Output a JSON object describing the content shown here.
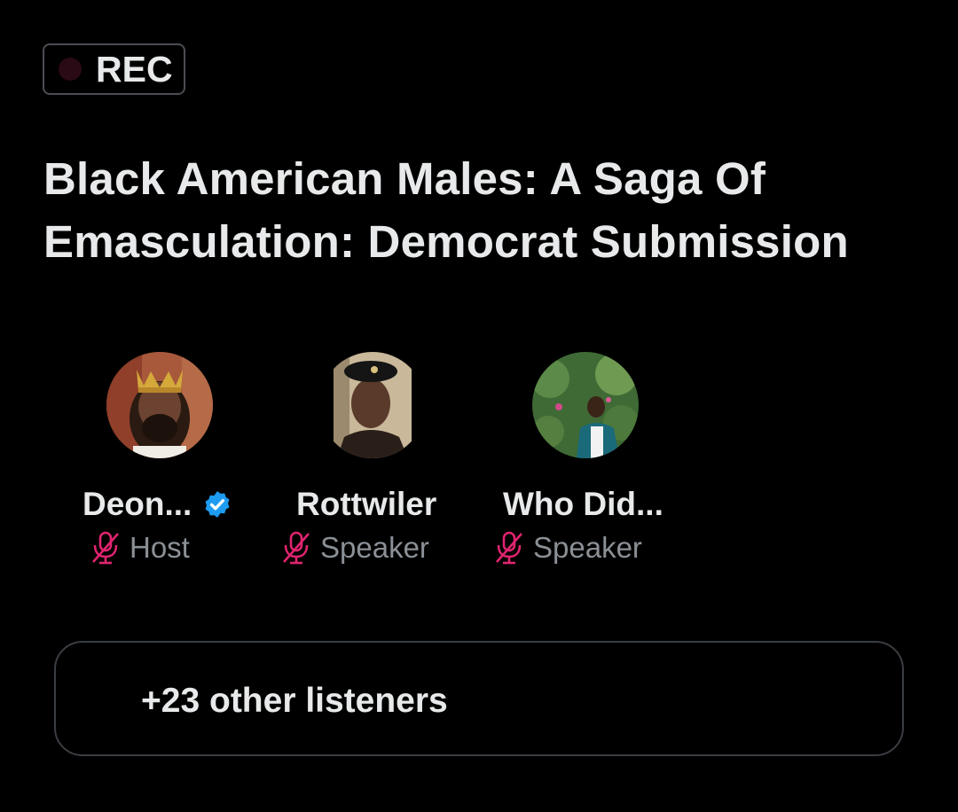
{
  "rec": {
    "label": "REC",
    "dot_color": "#2a0a14"
  },
  "space": {
    "title": "Black American Males: A Saga Of Emasculation: Democrat Submission"
  },
  "participants": [
    {
      "name": "Deon...",
      "role": "Host",
      "verified": true,
      "avatar": "crowned-man-avatar"
    },
    {
      "name": "Rottwiler",
      "role": "Speaker",
      "verified": false,
      "avatar": "man-in-beret-avatar"
    },
    {
      "name": "Who Did...",
      "role": "Speaker",
      "verified": false,
      "avatar": "woman-in-garden-avatar"
    }
  ],
  "listeners": {
    "label": "+23 other listeners"
  },
  "colors": {
    "background": "#000000",
    "text_primary": "#e7e9ea",
    "text_secondary": "#8b9096",
    "mic_muted": "#e0246f",
    "verified": "#1d9bf0",
    "border": "#3a3d42"
  }
}
